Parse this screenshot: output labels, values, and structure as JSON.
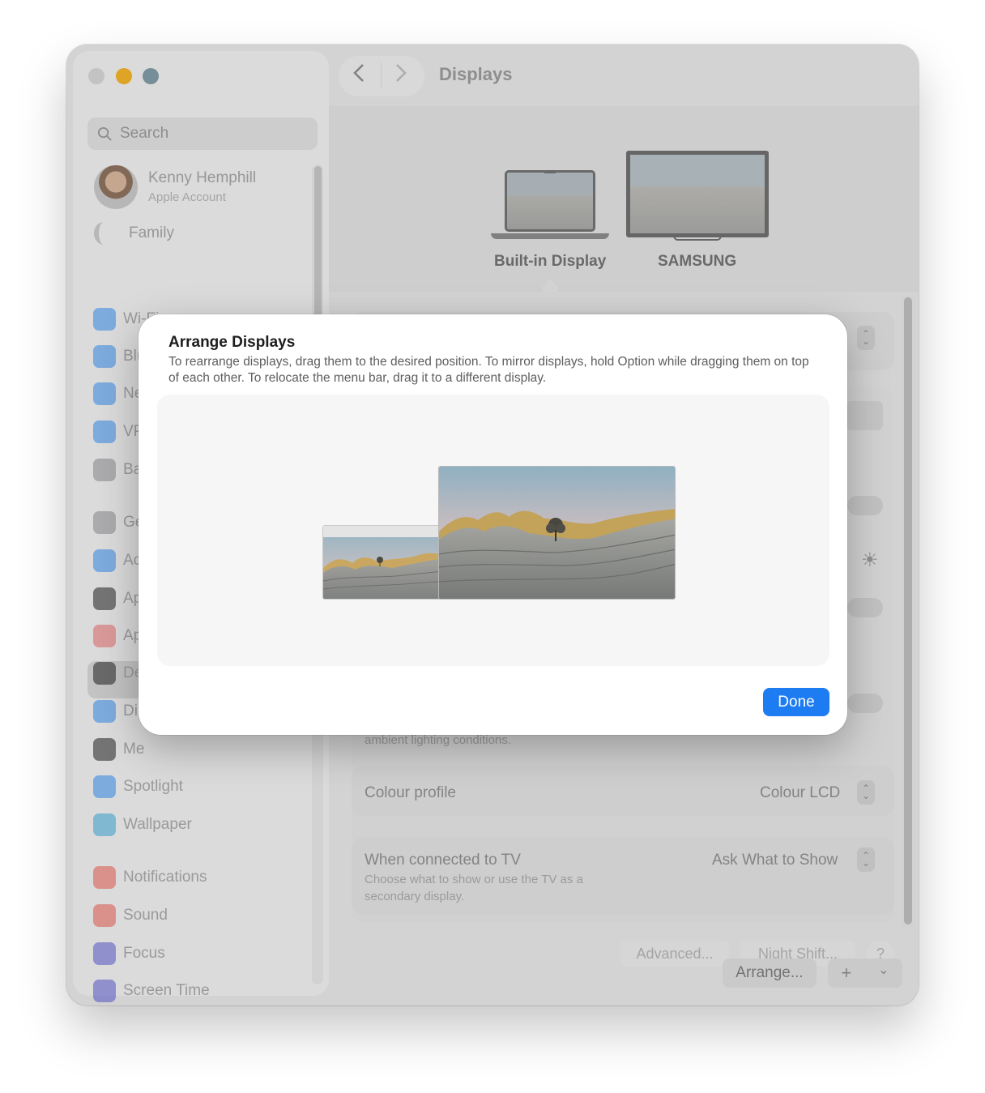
{
  "window": {
    "title": "Displays"
  },
  "sidebar": {
    "search_placeholder": "Search",
    "account": {
      "name": "Kenny Hemphill",
      "subtitle": "Apple Account"
    },
    "family_label": "Family",
    "items": [
      {
        "label": "Wi-Fi",
        "icon": "wifi-icon",
        "color": "#2f8ef7"
      },
      {
        "label": "Blu",
        "icon": "bluetooth-icon",
        "color": "#2f8ef7"
      },
      {
        "label": "Ne",
        "icon": "network-icon",
        "color": "#2f8ef7"
      },
      {
        "label": "VP",
        "icon": "vpn-icon",
        "color": "#2f8ef7"
      },
      {
        "label": "Ba",
        "icon": "battery-icon",
        "color": "#8e8e93"
      },
      {
        "label": "Ge",
        "icon": "gear-icon",
        "color": "#8e8e93"
      },
      {
        "label": "Ac",
        "icon": "accessibility-icon",
        "color": "#2f8ef7"
      },
      {
        "label": "Ap",
        "icon": "appearance-icon",
        "color": "#1d1d1f"
      },
      {
        "label": "Ap",
        "icon": "apple-intelligence-icon",
        "color": "#f06a6a"
      },
      {
        "label": "De",
        "icon": "desktop-dock-icon",
        "color": "#1d1d1f"
      },
      {
        "label": "Di",
        "icon": "displays-icon",
        "color": "#2f8ef7"
      },
      {
        "label": "Me",
        "icon": "menu-bar-icon",
        "color": "#1d1d1f"
      },
      {
        "label": "Spotlight",
        "icon": "spotlight-icon",
        "color": "#2f8ef7"
      },
      {
        "label": "Wallpaper",
        "icon": "wallpaper-icon",
        "color": "#34aadc"
      },
      {
        "label": "Notifications",
        "icon": "notifications-icon",
        "color": "#f05a4f"
      },
      {
        "label": "Sound",
        "icon": "sound-icon",
        "color": "#f05a4f"
      },
      {
        "label": "Focus",
        "icon": "focus-moon-icon",
        "color": "#5856d6"
      },
      {
        "label": "Screen Time",
        "icon": "hourglass-icon",
        "color": "#5856d6"
      }
    ]
  },
  "displays": {
    "builtin_label": "Built-in Display",
    "external_label": "SAMSUNG"
  },
  "main": {
    "ambient_text": "ambient lighting conditions.",
    "colour_profile_label": "Colour profile",
    "colour_profile_value": "Colour LCD",
    "tv_label": "When connected to TV",
    "tv_sub": "Choose what to show or use the TV as a secondary display.",
    "tv_value": "Ask What to Show",
    "advanced_label": "Advanced...",
    "night_shift_label": "Night Shift...",
    "help_label": "?",
    "arrange_label": "Arrange...",
    "add_label": "+",
    "chevron_label": "⌄"
  },
  "sheet": {
    "title": "Arrange Displays",
    "description": "To rearrange displays, drag them to the desired position. To mirror displays, hold Option while dragging them on top of each other. To relocate the menu bar, drag it to a different display.",
    "done_label": "Done"
  }
}
